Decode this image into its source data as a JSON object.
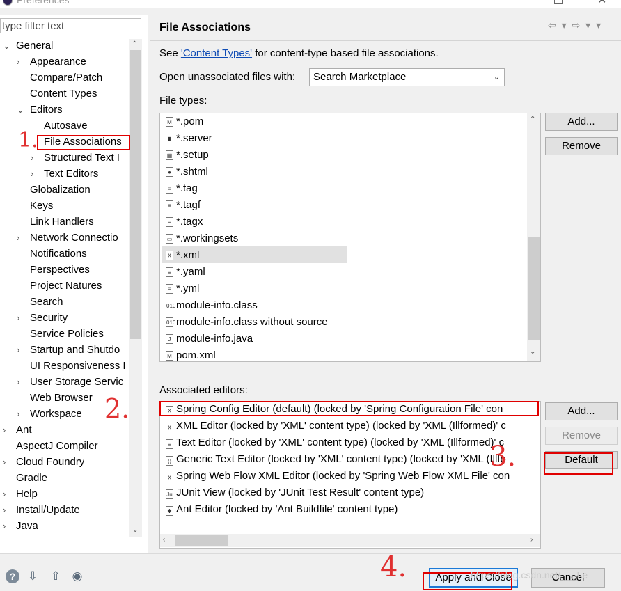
{
  "window": {
    "title": "Preferences"
  },
  "left": {
    "filter_placeholder": "type filter text",
    "tree": [
      {
        "label": "General",
        "twisty": "⌄",
        "level": 0
      },
      {
        "label": "Appearance",
        "twisty": "›",
        "level": 1
      },
      {
        "label": "Compare/Patch",
        "twisty": "",
        "level": 1
      },
      {
        "label": "Content Types",
        "twisty": "",
        "level": 1
      },
      {
        "label": "Editors",
        "twisty": "⌄",
        "level": 1
      },
      {
        "label": "Autosave",
        "twisty": "",
        "level": 2
      },
      {
        "label": "File Associations",
        "twisty": "",
        "level": 2
      },
      {
        "label": "Structured Text I",
        "twisty": "›",
        "level": 2
      },
      {
        "label": "Text Editors",
        "twisty": "›",
        "level": 2
      },
      {
        "label": "Globalization",
        "twisty": "",
        "level": 1
      },
      {
        "label": "Keys",
        "twisty": "",
        "level": 1
      },
      {
        "label": "Link Handlers",
        "twisty": "",
        "level": 1
      },
      {
        "label": "Network Connectio",
        "twisty": "›",
        "level": 1
      },
      {
        "label": "Notifications",
        "twisty": "",
        "level": 1
      },
      {
        "label": "Perspectives",
        "twisty": "",
        "level": 1
      },
      {
        "label": "Project Natures",
        "twisty": "",
        "level": 1
      },
      {
        "label": "Search",
        "twisty": "",
        "level": 1
      },
      {
        "label": "Security",
        "twisty": "›",
        "level": 1
      },
      {
        "label": "Service Policies",
        "twisty": "",
        "level": 1
      },
      {
        "label": "Startup and Shutdo",
        "twisty": "›",
        "level": 1
      },
      {
        "label": "UI Responsiveness I",
        "twisty": "",
        "level": 1
      },
      {
        "label": "User Storage Servic",
        "twisty": "›",
        "level": 1
      },
      {
        "label": "Web Browser",
        "twisty": "",
        "level": 1
      },
      {
        "label": "Workspace",
        "twisty": "›",
        "level": 1
      },
      {
        "label": "Ant",
        "twisty": "›",
        "level": 0
      },
      {
        "label": "AspectJ Compiler",
        "twisty": "",
        "level": 0
      },
      {
        "label": "Cloud Foundry",
        "twisty": "›",
        "level": 0
      },
      {
        "label": "Gradle",
        "twisty": "",
        "level": 0
      },
      {
        "label": "Help",
        "twisty": "›",
        "level": 0
      },
      {
        "label": "Install/Update",
        "twisty": "›",
        "level": 0
      },
      {
        "label": "Java",
        "twisty": "›",
        "level": 0
      }
    ]
  },
  "right": {
    "title": "File Associations",
    "nav": "⇦ ▾ ⇨ ▾ ▾",
    "see_prefix": "See ",
    "see_link": "'Content Types'",
    "see_suffix": " for content-type based file associations.",
    "open_label": "Open unassociated files with:",
    "open_value": "Search Marketplace",
    "file_types_label": "File types:",
    "file_types": [
      {
        "name": "*.pom",
        "icon": "M"
      },
      {
        "name": "*.server",
        "icon": "▮"
      },
      {
        "name": "*.setup",
        "icon": "▦"
      },
      {
        "name": "*.shtml",
        "icon": "●"
      },
      {
        "name": "*.tag",
        "icon": "≡"
      },
      {
        "name": "*.tagf",
        "icon": "≡"
      },
      {
        "name": "*.tagx",
        "icon": "≡"
      },
      {
        "name": "*.workingsets",
        "icon": "▭"
      },
      {
        "name": "*.xml",
        "icon": "X"
      },
      {
        "name": "*.yaml",
        "icon": "≡"
      },
      {
        "name": "*.yml",
        "icon": "≡"
      },
      {
        "name": "module-info.class",
        "icon": "010"
      },
      {
        "name": "module-info.class without source",
        "icon": "010"
      },
      {
        "name": "module-info.java",
        "icon": "J"
      },
      {
        "name": "pom.xml",
        "icon": "M"
      }
    ],
    "file_buttons": {
      "add": "Add...",
      "remove": "Remove"
    },
    "assoc_label": "Associated editors:",
    "assoc_editors": [
      {
        "name": "Spring Config Editor (default) (locked by 'Spring Configuration File' con",
        "icon": "X"
      },
      {
        "name": "XML Editor (locked by 'XML' content type) (locked by 'XML (Illformed)' c",
        "icon": "X"
      },
      {
        "name": "Text Editor (locked by 'XML' content type) (locked by 'XML (Illformed)' c",
        "icon": "≡"
      },
      {
        "name": "Generic Text Editor (locked by 'XML' content type) (locked by 'XML (Illfo",
        "icon": "{}"
      },
      {
        "name": "Spring Web Flow XML Editor (locked by 'Spring Web Flow XML File' con",
        "icon": "X"
      },
      {
        "name": "JUnit View (locked by 'JUnit Test Result' content type)",
        "icon": "Ju"
      },
      {
        "name": "Ant Editor (locked by 'Ant Buildfile' content type)",
        "icon": "✱"
      }
    ],
    "assoc_buttons": {
      "add": "Add...",
      "remove": "Remove",
      "default": "Default"
    }
  },
  "bottom": {
    "apply_close": "Apply and Close",
    "cancel": "Cancel",
    "watermark": "https://blog.csdn.net/___Le"
  },
  "annotations": {
    "n1": "1.",
    "n2": "2.",
    "n3": "3.",
    "n4": "4."
  },
  "colors": {
    "highlight": "#e00000",
    "link": "#0f4cb5",
    "focus": "#1c79d6"
  }
}
